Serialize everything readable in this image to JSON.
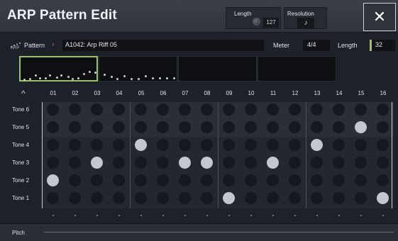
{
  "header": {
    "title": "ARP Pattern Edit",
    "length_label": "Length",
    "length_value": "127",
    "resolution_label": "Resolution",
    "resolution_value": "♪",
    "close_label": "✕"
  },
  "pattern": {
    "icon_label": "ARP",
    "label": "Pattern",
    "chevron": "›",
    "value": "A1042: Arp Riff 05",
    "meter_label": "Meter",
    "meter_value": "4/4",
    "length_label": "Length",
    "length_value": "32"
  },
  "overview": {
    "selected_segment": 0,
    "segment_count": 4
  },
  "grid": {
    "up_arrow": "^",
    "steps": [
      "01",
      "02",
      "03",
      "04",
      "05",
      "06",
      "07",
      "08",
      "09",
      "10",
      "11",
      "12",
      "13",
      "14",
      "15",
      "16"
    ],
    "rows": [
      "Tone 6",
      "Tone 5",
      "Tone 4",
      "Tone 3",
      "Tone 2",
      "Tone 1"
    ],
    "active": [
      {
        "step": 1,
        "tone": "Tone 2"
      },
      {
        "step": 3,
        "tone": "Tone 3"
      },
      {
        "step": 5,
        "tone": "Tone 4"
      },
      {
        "step": 7,
        "tone": "Tone 3"
      },
      {
        "step": 8,
        "tone": "Tone 3"
      },
      {
        "step": 9,
        "tone": "Tone 1"
      },
      {
        "step": 11,
        "tone": "Tone 3"
      },
      {
        "step": 13,
        "tone": "Tone 4"
      },
      {
        "step": 15,
        "tone": "Tone 5"
      },
      {
        "step": 16,
        "tone": "Tone 1"
      }
    ]
  },
  "pitch": {
    "label": "Pitch"
  },
  "colors": {
    "accent_green": "#9dc45c",
    "chevron_red": "#d4536a",
    "active_cell": "#c4c7cf",
    "inactive_cell": "#141820"
  }
}
